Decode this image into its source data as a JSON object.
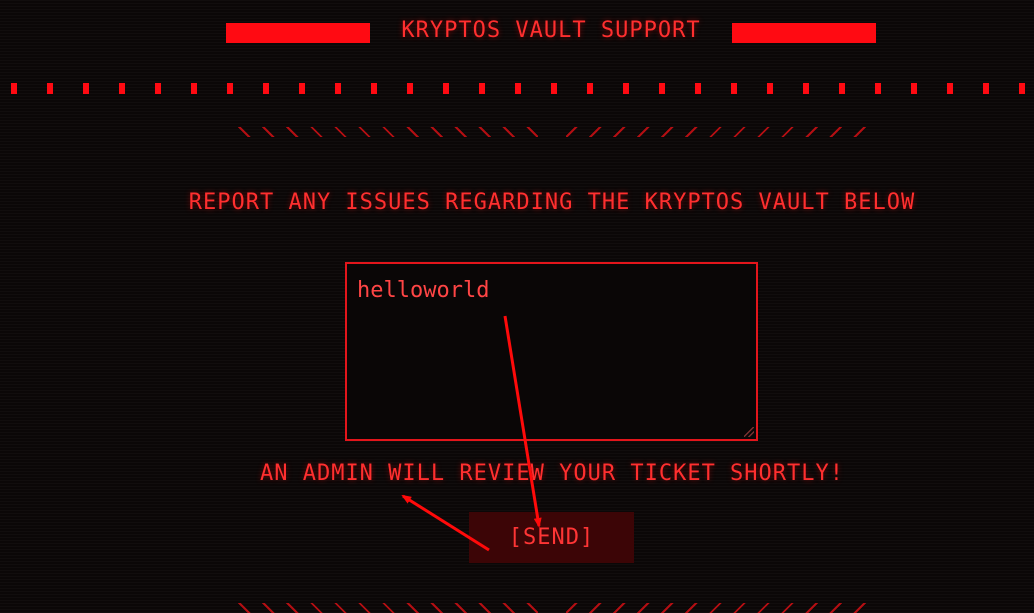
{
  "header": {
    "title": "KRYPTOS VAULT SUPPORT"
  },
  "main": {
    "heading": "REPORT ANY ISSUES REGARDING THE KRYPTOS VAULT BELOW",
    "ticket_value": "helloworld",
    "note": "AN ADMIN WILL REVIEW YOUR TICKET SHORTLY!",
    "send_label": "[SEND]"
  },
  "colors": {
    "accent": "#ff0a12",
    "text": "#ff2f2f",
    "background": "#0b0707",
    "button_bg": "#3c0506",
    "hatch": "#b30e12"
  }
}
